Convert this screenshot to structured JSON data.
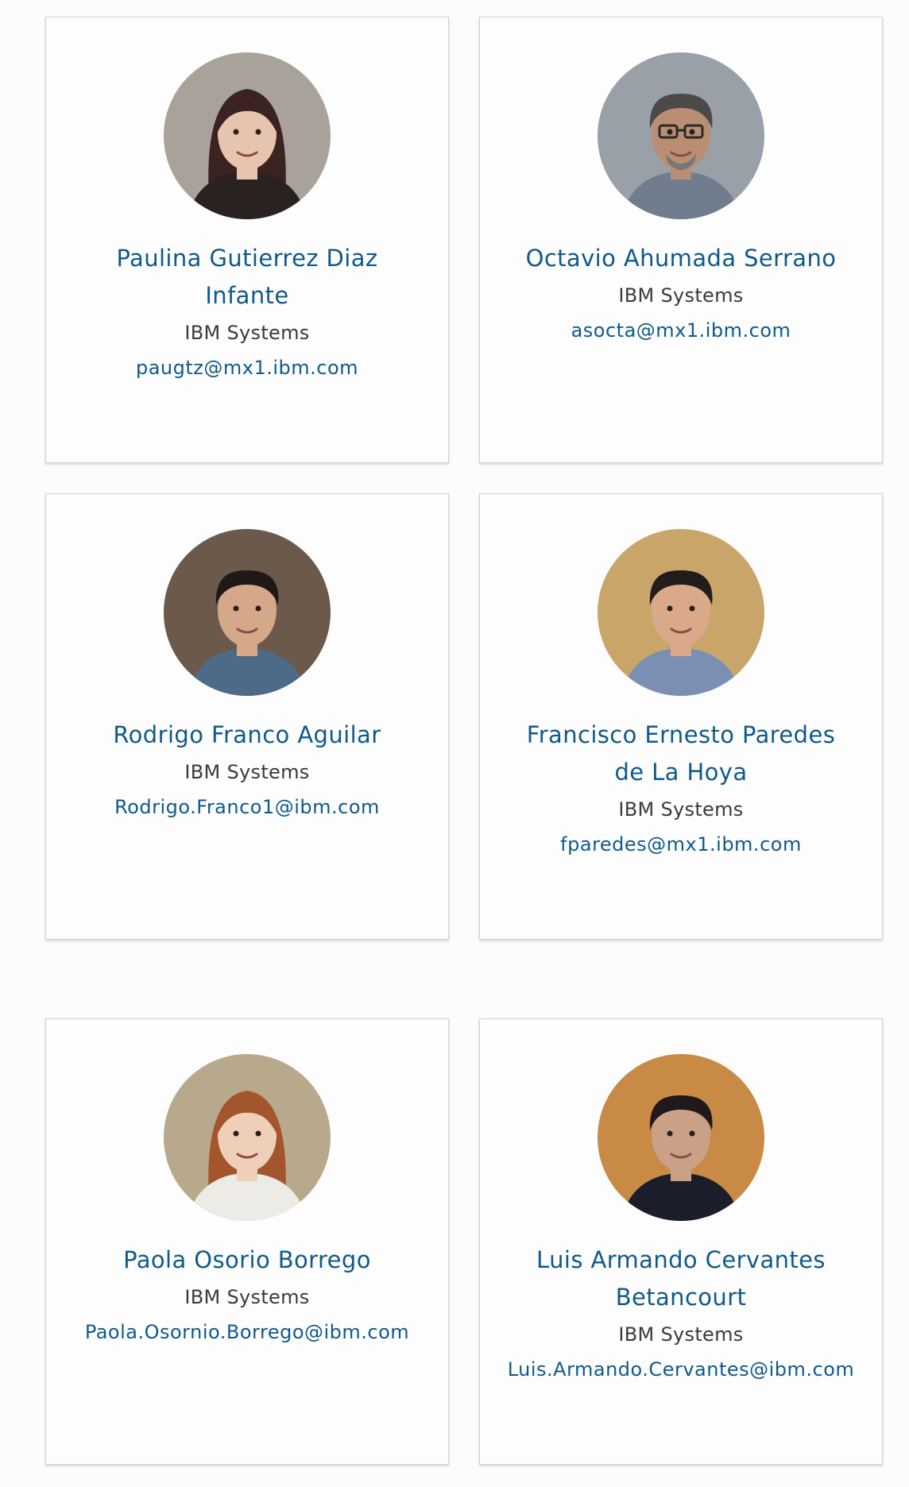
{
  "people": [
    {
      "name": "Paulina Gutierrez Diaz Infante",
      "organization": "IBM Systems",
      "email": "paugtz@mx1.ibm.com",
      "avatar_icon": "woman-portrait",
      "avatar_colors": {
        "bg": "#a8a29a",
        "skin": "#e7c4ad",
        "hair": "#3a2320",
        "shirt": "#2a2220"
      }
    },
    {
      "name": "Octavio Ahumada Serrano",
      "organization": "IBM Systems",
      "email": "asocta@mx1.ibm.com",
      "avatar_icon": "man-glasses-portrait",
      "avatar_colors": {
        "bg": "#9aa0a8",
        "skin": "#b98e72",
        "hair": "#4c4a48",
        "shirt": "#6f7d8f"
      }
    },
    {
      "name": "Rodrigo Franco Aguilar",
      "organization": "IBM Systems",
      "email": "Rodrigo.Franco1@ibm.com",
      "avatar_icon": "man-portrait",
      "avatar_colors": {
        "bg": "#6b5a4c",
        "skin": "#d6a88a",
        "hair": "#1f1a18",
        "shirt": "#4d6a86"
      }
    },
    {
      "name": "Francisco Ernesto Paredes de La Hoya",
      "organization": "IBM Systems",
      "email": "fparedes@mx1.ibm.com",
      "avatar_icon": "man-portrait",
      "avatar_colors": {
        "bg": "#caa56a",
        "skin": "#d9a98a",
        "hair": "#221c1a",
        "shirt": "#7b8fb3"
      }
    },
    {
      "name": "Paola Osorio Borrego",
      "organization": "IBM Systems",
      "email": "Paola.Osornio.Borrego@ibm.com",
      "avatar_icon": "woman-portrait",
      "avatar_colors": {
        "bg": "#b9a98c",
        "skin": "#f0cfb8",
        "hair": "#a3562d",
        "shirt": "#ecebe6"
      }
    },
    {
      "name": "Luis Armando Cervantes Betancourt",
      "organization": "IBM Systems",
      "email": "Luis.Armando.Cervantes@ibm.com",
      "avatar_icon": "man-portrait",
      "avatar_colors": {
        "bg": "#c98a46",
        "skin": "#caa087",
        "hair": "#20181a",
        "shirt": "#1a1d2a"
      }
    }
  ]
}
